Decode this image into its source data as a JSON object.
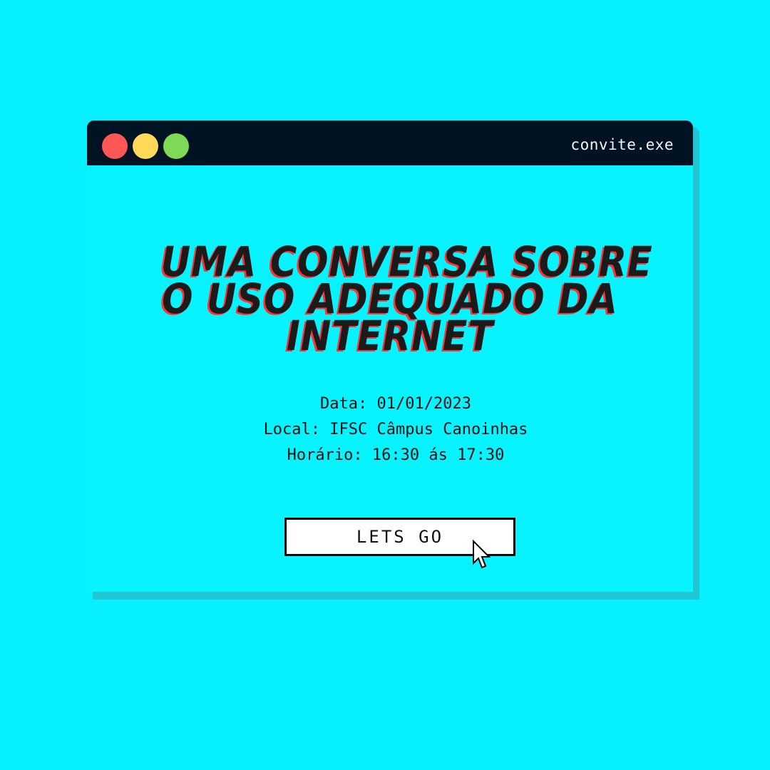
{
  "background_color": "#06f0ff",
  "window": {
    "title": "convite.exe",
    "traffic_lights": [
      {
        "name": "close",
        "color": "#ff5656"
      },
      {
        "name": "minimize",
        "color": "#ffd957"
      },
      {
        "name": "maximize",
        "color": "#7ed957"
      }
    ]
  },
  "headline": {
    "line1": "UMA CONVERSA SOBRE",
    "line2": "O USO ADEQUADO DA",
    "line3": "INTERNET",
    "text_color": "#1b1b1b",
    "shadow_color": "#ff3131"
  },
  "details": {
    "date": "Data: 01/01/2023",
    "location": "Local: IFSC Câmpus Canoinhas",
    "time": "Horário: 16:30 ás 17:30"
  },
  "cta": {
    "label": "LETS GO"
  },
  "icons": {
    "cursor": "pointer-cursor-icon"
  }
}
